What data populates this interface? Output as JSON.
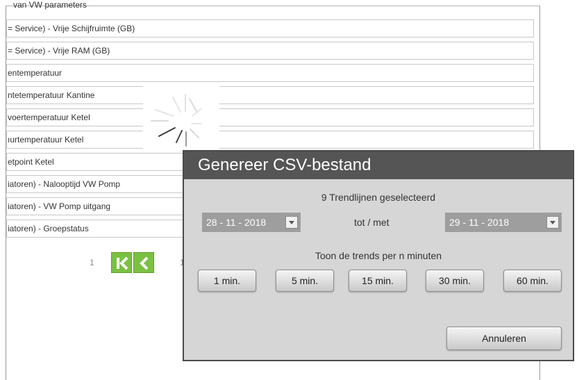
{
  "list": {
    "top_clipped": "van VW parameters",
    "items": [
      "= Service)  - Vrije Schijfruimte (GB)",
      "= Service)  - Vrije RAM (GB)",
      "entemperatuur",
      "ntetemperatuur Kantine",
      "voertemperatuur Ketel",
      "ıurtemperatuur Ketel",
      "etpoint Ketel",
      "iatoren)  - Nalooptijd VW Pomp",
      "iatoren)  - VW Pomp uitgang",
      "iatoren)  - Groepstatus"
    ]
  },
  "pager": {
    "current_page": "1",
    "next_page_partial": "1"
  },
  "dialog": {
    "title": "Genereer CSV-bestand",
    "selected_text": "9 Trendlijnen geselecteerd",
    "date_from": "28 - 11 -  2018",
    "range_separator": "tot / met",
    "date_to": "29 - 11 -  2018",
    "interval_text": "Toon de trends per n minuten",
    "interval_buttons": [
      "1 min.",
      "5 min.",
      "15 min.",
      "30 min.",
      "60 min."
    ],
    "cancel_label": "Annuleren"
  },
  "colors": {
    "dialog_header": "#555555",
    "dialog_body": "#d6d6d6",
    "pager_green": "#7ac142",
    "date_select": "#9e9e9e"
  },
  "icons": [
    "loading-spinner-icon",
    "first-page-icon",
    "previous-page-icon",
    "chevron-down-icon"
  ]
}
